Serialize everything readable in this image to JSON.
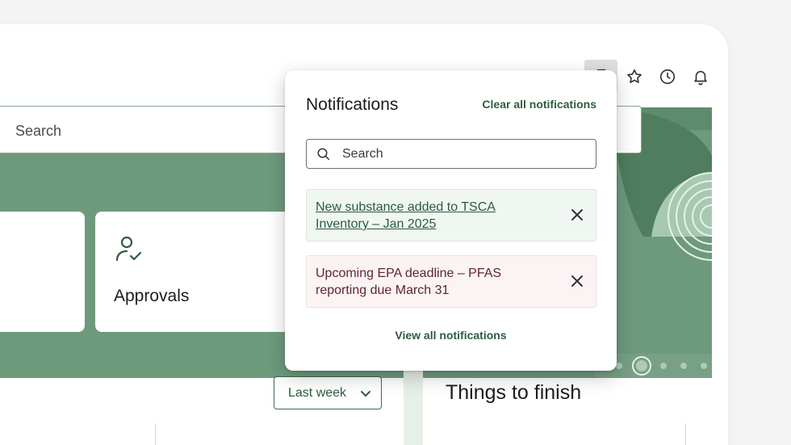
{
  "toolbar": {
    "icons": [
      "hourglass-icon",
      "star-icon",
      "clock-icon",
      "bell-icon"
    ]
  },
  "hero": {
    "search_placeholder": "Search"
  },
  "cards": [
    {
      "label": ""
    },
    {
      "label": "Approvals",
      "icon": "user-check-icon"
    }
  ],
  "filter": {
    "selected": "Last week"
  },
  "section": {
    "title": "Things to finish"
  },
  "notifications": {
    "title": "Notifications",
    "clear_all": "Clear all notifications",
    "search_placeholder": "Search",
    "items": [
      {
        "text": "New substance added to TSCA Inventory – Jan 2025",
        "type": "info"
      },
      {
        "text": "Upcoming EPA deadline – PFAS reporting due March 31",
        "type": "warning"
      }
    ],
    "view_all": "View all notifications"
  },
  "colors": {
    "brand_green": "#6e9a7c",
    "link_green": "#2d5c3f",
    "warning_text": "#5e2535"
  }
}
